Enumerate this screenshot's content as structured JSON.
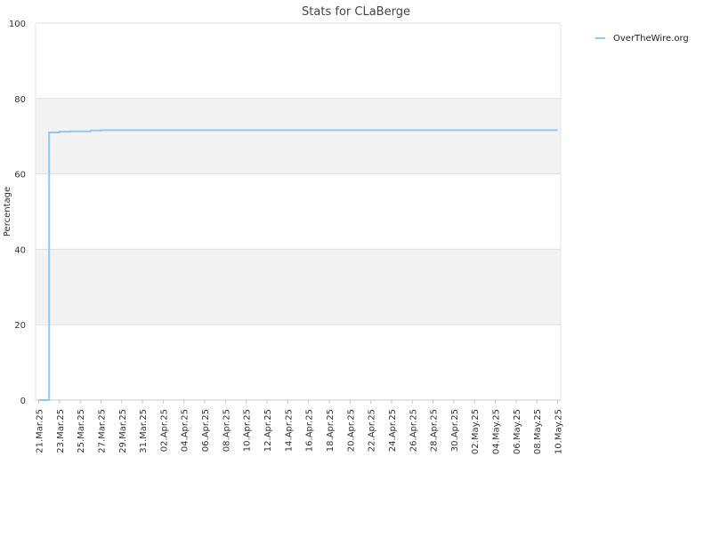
{
  "chart_data": {
    "type": "line",
    "title": "Stats for CLaBerge",
    "xlabel": "",
    "ylabel": "Percentage",
    "ylim": [
      0,
      100
    ],
    "yticks": [
      0,
      20,
      40,
      60,
      80,
      100
    ],
    "xlim": [
      "2025-03-21",
      "2025-05-10"
    ],
    "x_tick_labels": [
      "21.Mar.25",
      "23.Mar.25",
      "25.Mar.25",
      "27.Mar.25",
      "29.Mar.25",
      "31.Mar.25",
      "02.Apr.25",
      "04.Apr.25",
      "06.Apr.25",
      "08.Apr.25",
      "10.Apr.25",
      "12.Apr.25",
      "14.Apr.25",
      "16.Apr.25",
      "18.Apr.25",
      "20.Apr.25",
      "22.Apr.25",
      "24.Apr.25",
      "26.Apr.25",
      "28.Apr.25",
      "30.Apr.25",
      "02.May.25",
      "04.May.25",
      "06.May.25",
      "08.May.25",
      "10.May.25"
    ],
    "grid": "horizontal, alternating bands",
    "legend_position": "top-right",
    "series": [
      {
        "name": "OverTheWire.org",
        "color": "#90c8f0",
        "x": [
          "2025-03-21",
          "2025-03-21",
          "2025-03-21",
          "2025-03-22",
          "2025-03-23",
          "2025-03-24",
          "2025-03-25",
          "2025-03-26",
          "2025-03-27",
          "2025-03-28",
          "2025-05-10"
        ],
        "y": [
          0,
          0,
          0,
          71,
          71.2,
          71.3,
          71.3,
          71.5,
          71.6,
          71.6,
          71.6
        ]
      }
    ]
  }
}
